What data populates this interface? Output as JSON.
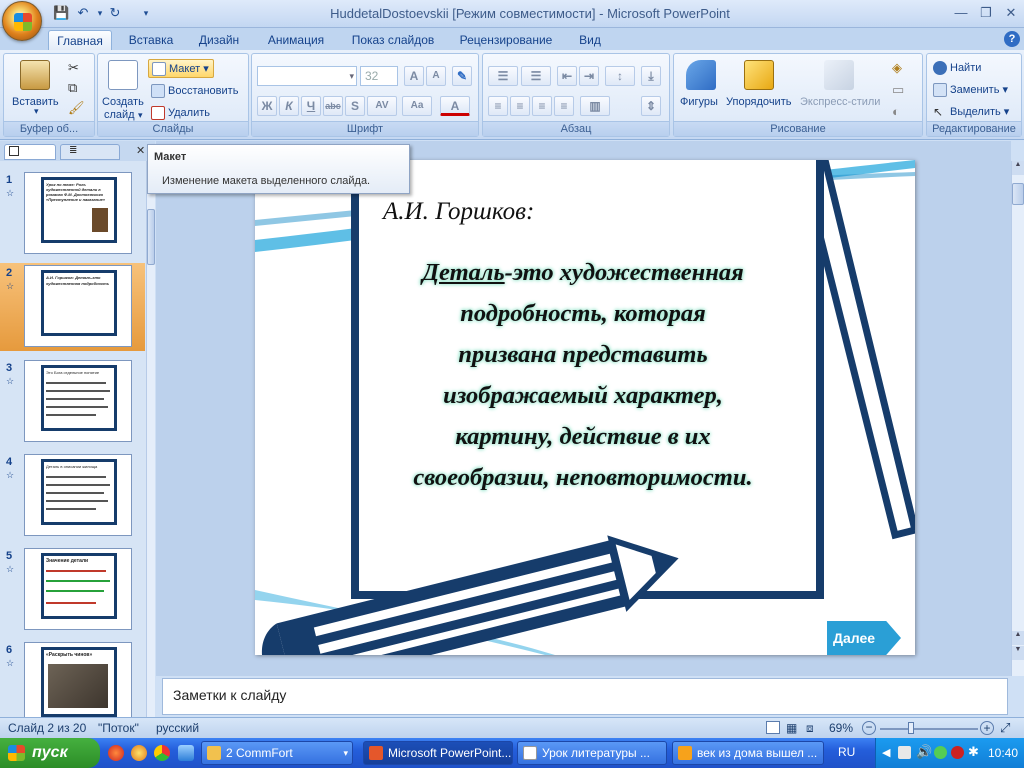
{
  "window": {
    "title": "HuddetalDostoevskii [Режим совместимости] - Microsoft PowerPoint"
  },
  "tabs": [
    "Главная",
    "Вставка",
    "Дизайн",
    "Анимация",
    "Показ слайдов",
    "Рецензирование",
    "Вид"
  ],
  "ribbon": {
    "clipboard": {
      "title": "Буфер об...",
      "paste": "Вставить"
    },
    "slides": {
      "title": "Слайды",
      "new_slide_1": "Создать",
      "new_slide_2": "слайд",
      "layout": "Макет",
      "reset": "Восстановить",
      "delete": "Удалить"
    },
    "font": {
      "title": "Шрифт",
      "size": "32",
      "bold": "Ж",
      "italic": "К",
      "underline": "Ч",
      "strike": "abc",
      "shadow": "S",
      "spacing": "AV",
      "case": "Aa",
      "color": "A"
    },
    "paragraph": {
      "title": "Абзац"
    },
    "drawing": {
      "title": "Рисование",
      "shapes": "Фигуры",
      "arrange": "Упорядочить",
      "styles": "Экспресс-стили"
    },
    "editing": {
      "title": "Редактирование",
      "find": "Найти",
      "replace": "Заменить",
      "select": "Выделить"
    }
  },
  "tooltip": {
    "title": "Макет",
    "text": "Изменение макета выделенного слайда."
  },
  "slide": {
    "author": "А.И.  Горшков:",
    "term": "Деталь",
    "definition_lines": [
      "-это  художественная",
      "подробность,  которая",
      "призвана  представить",
      "изображаемый  характер,",
      "картину,  действие   в  их",
      "своеобразии,  неповторимости."
    ],
    "next_button": "Далее"
  },
  "thumbnails": [
    {
      "num": "1",
      "title": "Урок   по   теме: Роль художественной детали в романах Ф.М. Достоевского «Преступление и наказание»"
    },
    {
      "num": "2",
      "title": "А.И.  Горшков: Деталь-это художественная подробность"
    },
    {
      "num": "3",
      "title": "Это  Бога  отдельное  понятие"
    },
    {
      "num": "4",
      "title": "Деталь в  описании  жилища"
    },
    {
      "num": "5",
      "title": "Значение детали"
    },
    {
      "num": "6",
      "title": "«Раскрыть  чинов»"
    }
  ],
  "notes": {
    "placeholder": "Заметки к слайду"
  },
  "status": {
    "slide": "Слайд 2 из 20",
    "theme": "\"Поток\"",
    "lang": "русский",
    "zoom": "69%"
  },
  "taskbar": {
    "start": "пуск",
    "tasks": [
      "2 CommFort",
      "Microsoft PowerPoint...",
      "Урок  литературы  ...",
      "век из дома вышел ..."
    ],
    "lang": "RU",
    "clock": "10:40"
  }
}
